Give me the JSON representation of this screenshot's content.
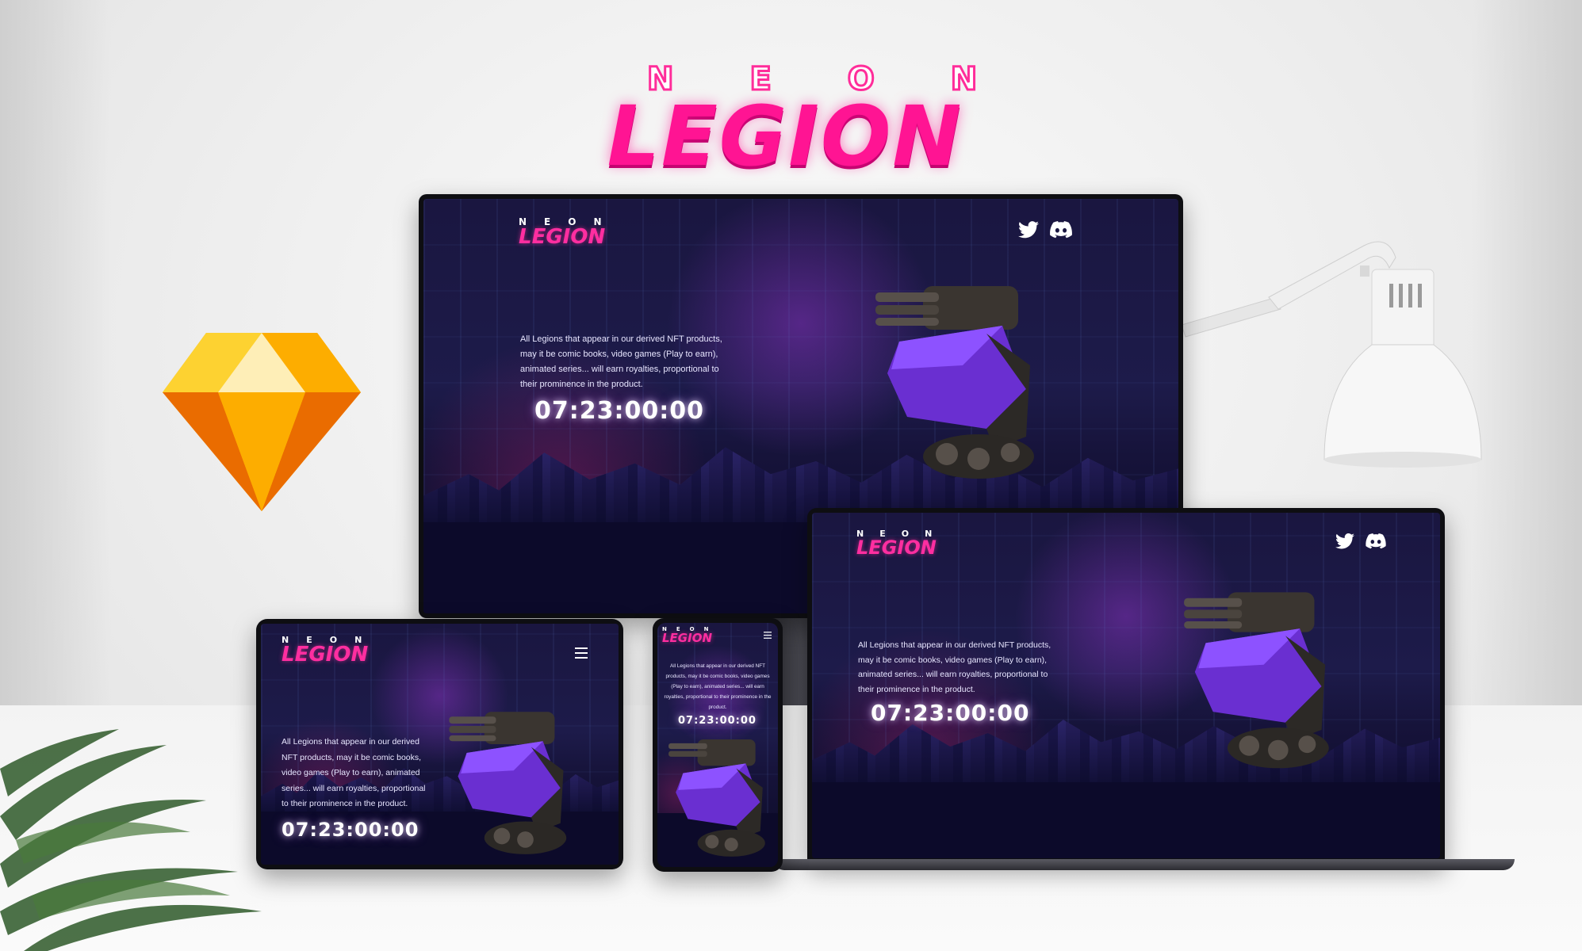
{
  "brand": {
    "top": "NEON",
    "main": "LEGION"
  },
  "site": {
    "logo_top": "NEON",
    "logo_main": "LEGION",
    "description_lines": [
      "All Legions that appear in our derived NFT products,",
      "may it be comic books, video games (Play to earn),",
      "animated series... will earn royalties, proportional to",
      "their prominence in the product."
    ],
    "tablet_description_lines": [
      "All Legions that appear in our derived",
      "NFT products, may it be comic books,",
      "video games (Play to earn), animated",
      "series... will earn royalties, proportional",
      "to their prominence in the product."
    ],
    "phone_description_lines": [
      "All Legions that appear in our derived NFT",
      "products, may it be comic books, video games",
      "(Play to earn), animated series... will earn",
      "royalties, proportional to their prominence in the",
      "product."
    ],
    "countdown": "07:23:00:00"
  },
  "colors": {
    "accent": "#ff1493",
    "bg_dark": "#1a1640",
    "sketch_yellow": "#fdb300"
  },
  "icons": [
    "twitter-icon",
    "discord-icon",
    "menu-icon",
    "sketch-logo-icon"
  ]
}
